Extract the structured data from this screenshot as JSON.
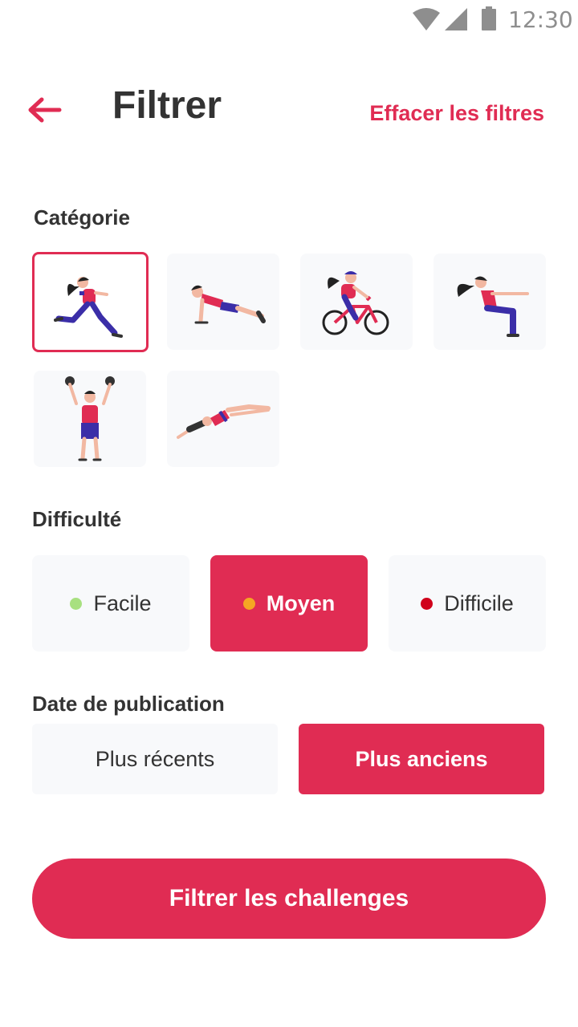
{
  "status_bar": {
    "time": "12:30",
    "icons": [
      "wifi-icon",
      "signal-icon",
      "battery-icon"
    ]
  },
  "header": {
    "title": "Filtrer",
    "clear_label": "Effacer les filtres",
    "back_icon": "arrow-left-icon"
  },
  "category": {
    "label": "Catégorie",
    "items": [
      {
        "name": "running",
        "selected": true
      },
      {
        "name": "plank",
        "selected": false
      },
      {
        "name": "cycling",
        "selected": false
      },
      {
        "name": "squat",
        "selected": false
      },
      {
        "name": "weightlifting",
        "selected": false
      },
      {
        "name": "diving",
        "selected": false
      }
    ]
  },
  "difficulty": {
    "label": "Difficulté",
    "options": [
      {
        "label": "Facile",
        "dot_color": "#a8e080",
        "active": false
      },
      {
        "label": "Moyen",
        "dot_color": "#f5a623",
        "active": true
      },
      {
        "label": "Difficile",
        "dot_color": "#d0021b",
        "active": false
      }
    ]
  },
  "date": {
    "label": "Date de publication",
    "options": [
      {
        "label": "Plus récents",
        "active": false
      },
      {
        "label": "Plus anciens",
        "active": true
      }
    ]
  },
  "submit_label": "Filtrer les challenges",
  "colors": {
    "accent": "#e02c53",
    "tile_bg": "#f8f9fb",
    "text": "#333333"
  }
}
